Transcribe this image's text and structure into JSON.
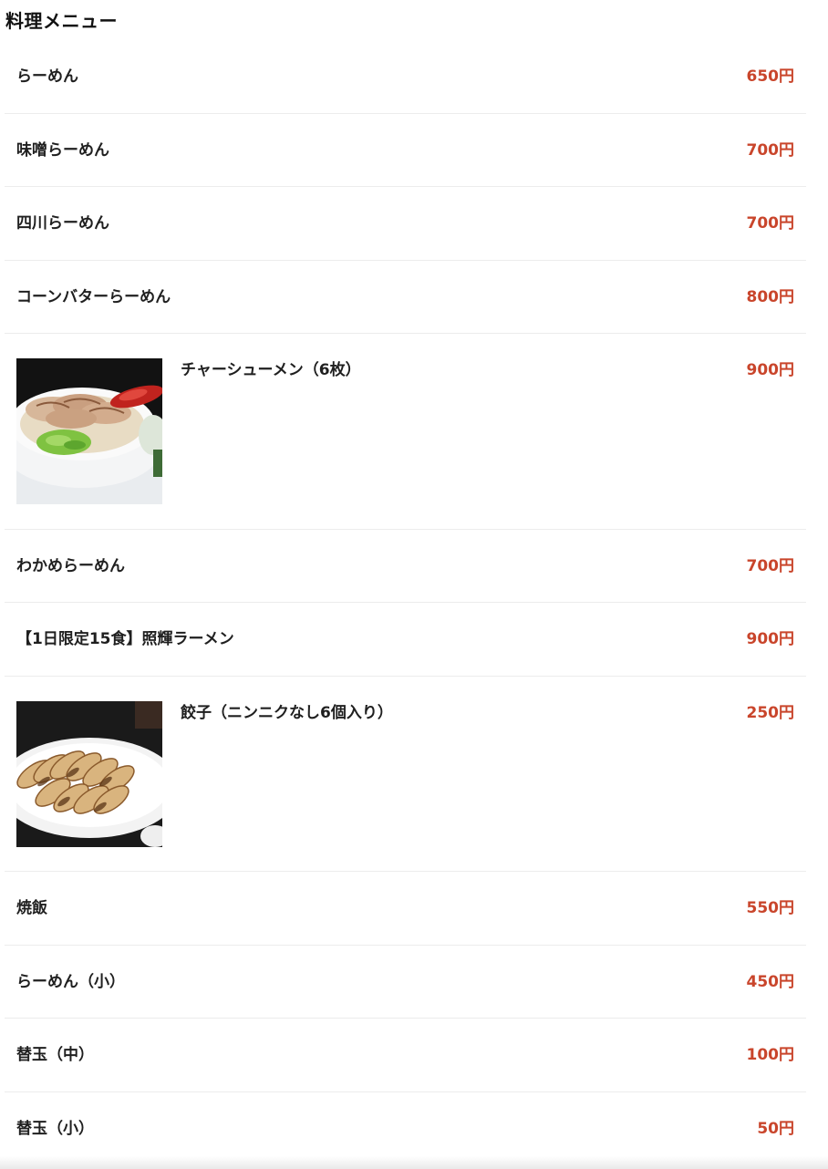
{
  "section": {
    "title": "料理メニュー"
  },
  "menu": {
    "items": [
      {
        "name": "らーめん",
        "price": "650円"
      },
      {
        "name": "味噌らーめん",
        "price": "700円"
      },
      {
        "name": "四川らーめん",
        "price": "700円"
      },
      {
        "name": "コーンバターらーめん",
        "price": "800円"
      },
      {
        "name": "チャーシューメン（6枚）",
        "price": "900円",
        "photo": "chashu-ramen-photo"
      },
      {
        "name": "わかめらーめん",
        "price": "700円"
      },
      {
        "name": "【1日限定15食】照輝ラーメン",
        "price": "900円"
      },
      {
        "name": "餃子（ニンニクなし6個入り）",
        "price": "250円",
        "photo": "gyoza-photo"
      },
      {
        "name": "焼飯",
        "price": "550円"
      },
      {
        "name": "らーめん（小）",
        "price": "450円"
      },
      {
        "name": "替玉（中）",
        "price": "100円"
      },
      {
        "name": "替玉（小）",
        "price": "50円"
      }
    ]
  },
  "colors": {
    "price": "#c9452b",
    "text": "#1f1f1f",
    "divider": "#ececec"
  }
}
